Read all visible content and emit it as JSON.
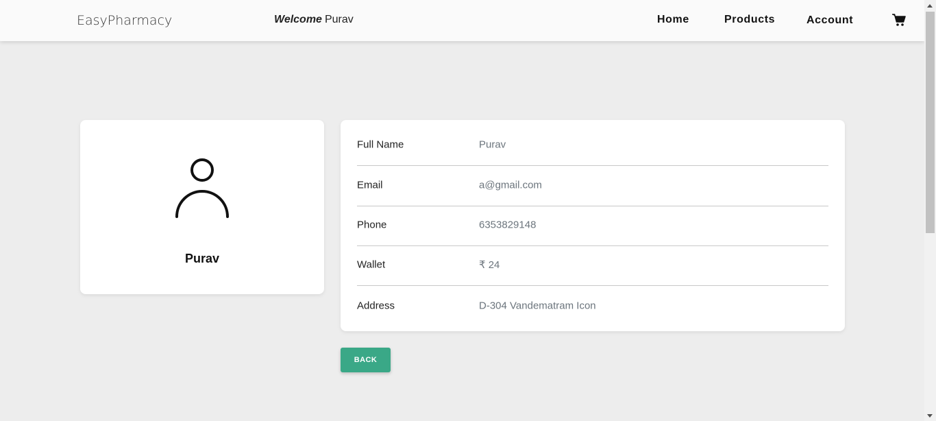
{
  "navbar": {
    "brand": "EasyPharmacy",
    "welcome_prefix": "Welcome",
    "welcome_name": "Purav",
    "links": {
      "home": "Home",
      "products": "Products",
      "account": "Account"
    },
    "cart_icon": "shopping-cart-icon"
  },
  "profile": {
    "avatar_icon": "user-icon",
    "name": "Purav"
  },
  "details": [
    {
      "label": "Full Name",
      "value": "Purav"
    },
    {
      "label": "Email",
      "value": "a@gmail.com"
    },
    {
      "label": "Phone",
      "value": "6353829148"
    },
    {
      "label": "Wallet",
      "value": "₹ 24"
    },
    {
      "label": "Address",
      "value": "D-304 Vandematram Icon"
    }
  ],
  "actions": {
    "back_label": "BACK"
  },
  "colors": {
    "page_background": "#ededed",
    "navbar_background": "#fafafa",
    "back_button": "#3aa887",
    "muted_text": "#6c757d"
  }
}
